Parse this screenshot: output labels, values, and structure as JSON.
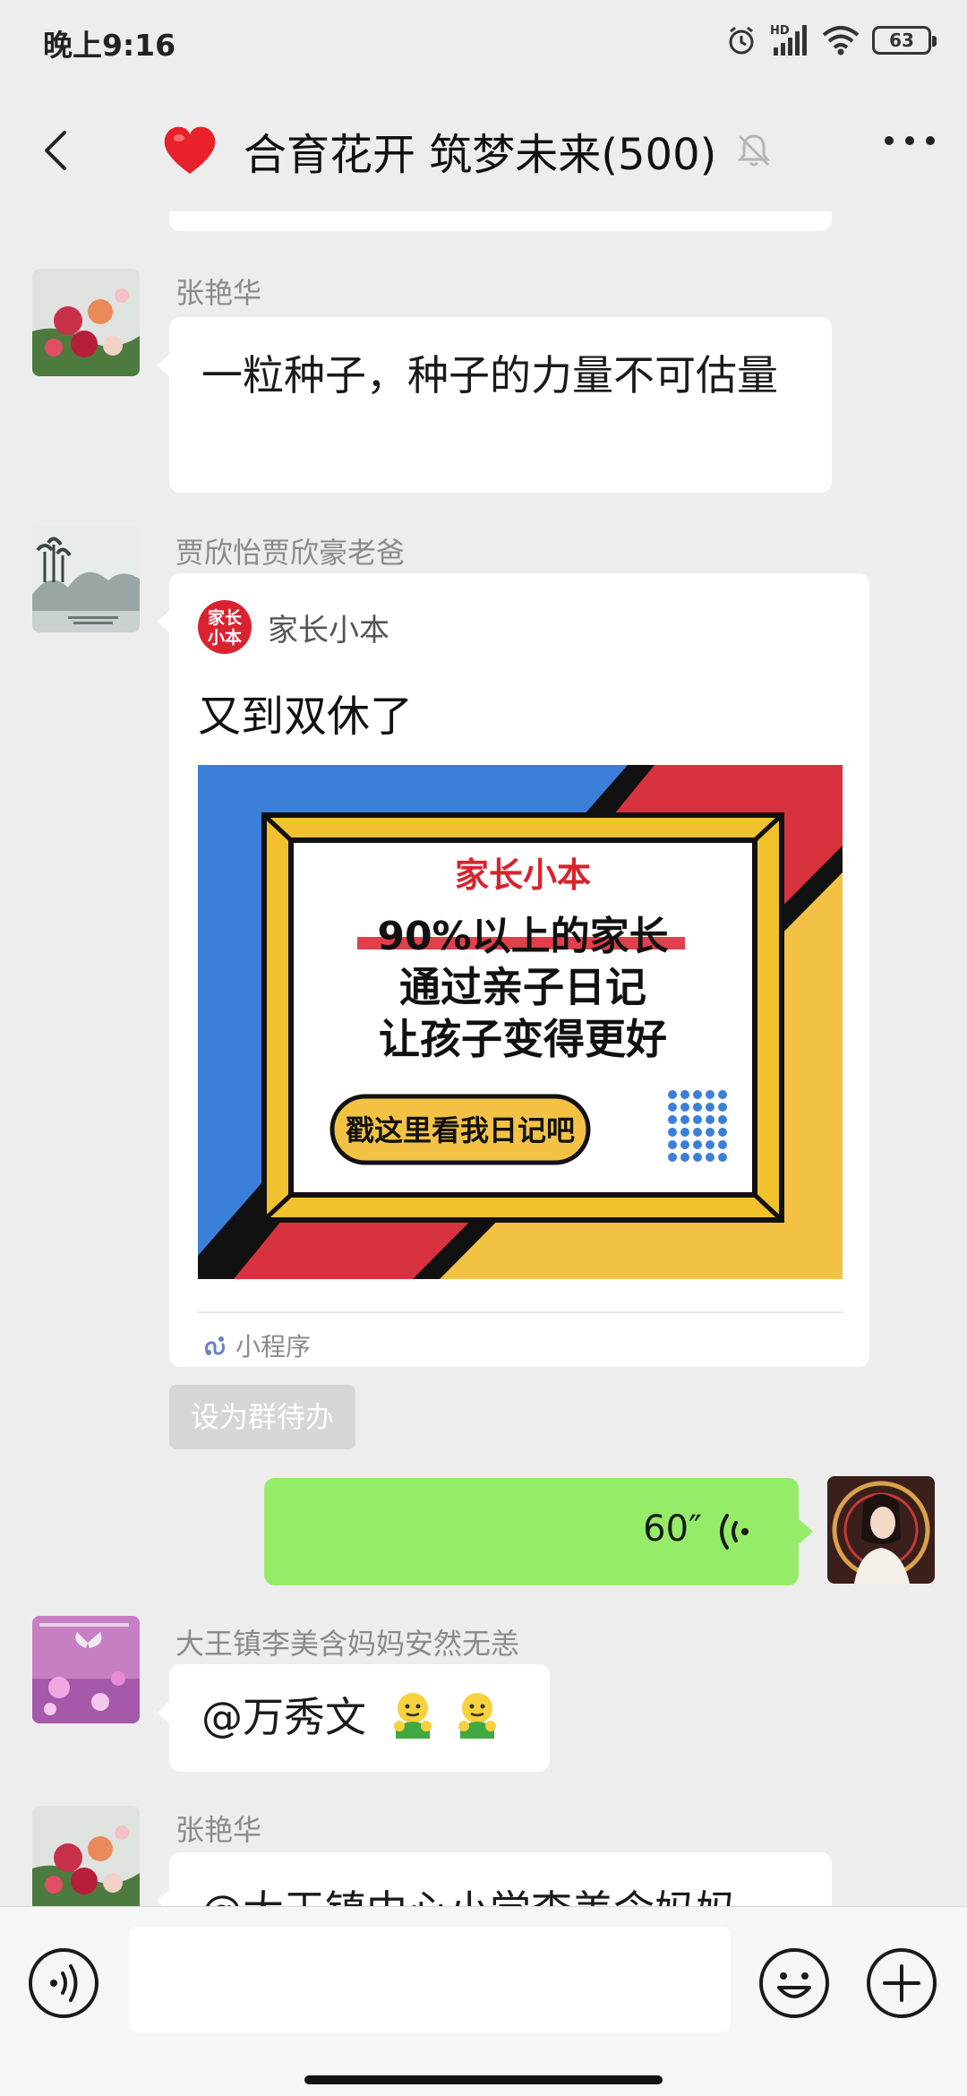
{
  "status_bar": {
    "time": "晚上9:16",
    "hd_label": "HD",
    "battery": "63"
  },
  "header": {
    "title": "合育花开 筑梦未来(500)",
    "icons": [
      "back-arrow-icon",
      "heart-icon",
      "mute-bell-icon",
      "more-dots-icon"
    ]
  },
  "messages": [
    {
      "type": "text",
      "sender": "张艳华",
      "text": "一粒种子，种子的力量不可估量"
    },
    {
      "type": "mini_program",
      "sender": "贾欣怡贾欣豪老爸",
      "source_name": "家长小本",
      "logo_text": "家长小本",
      "title": "又到双休了",
      "banner": {
        "brand": "家长小本",
        "line1": "90%以上的家长",
        "line2": "通过亲子日记",
        "line3": "让孩子变得更好",
        "button": "戳这里看我日记吧",
        "colors": {
          "blue": "#3b7fd9",
          "red": "#d9323f",
          "yellow": "#f3c245",
          "frame": "#f2c12e"
        }
      },
      "footer_label": "小程序"
    },
    {
      "type": "action",
      "label": "设为群待办"
    },
    {
      "type": "voice",
      "duration": "60″",
      "from_self": true
    },
    {
      "type": "text",
      "sender": "大王镇李美含妈妈安然无恙",
      "text": "@万秀文"
    },
    {
      "type": "text",
      "sender": "张艳华",
      "text": "@大王镇中心小学李美含妈妈"
    }
  ],
  "input_bar": {
    "placeholder": "",
    "icons": [
      "voice-toggle-icon",
      "emoji-icon",
      "plus-icon"
    ]
  },
  "colors": {
    "background": "#ededed",
    "self_bubble": "#95ec69",
    "other_bubble": "#ffffff",
    "sender_text": "#8a8a8a"
  }
}
